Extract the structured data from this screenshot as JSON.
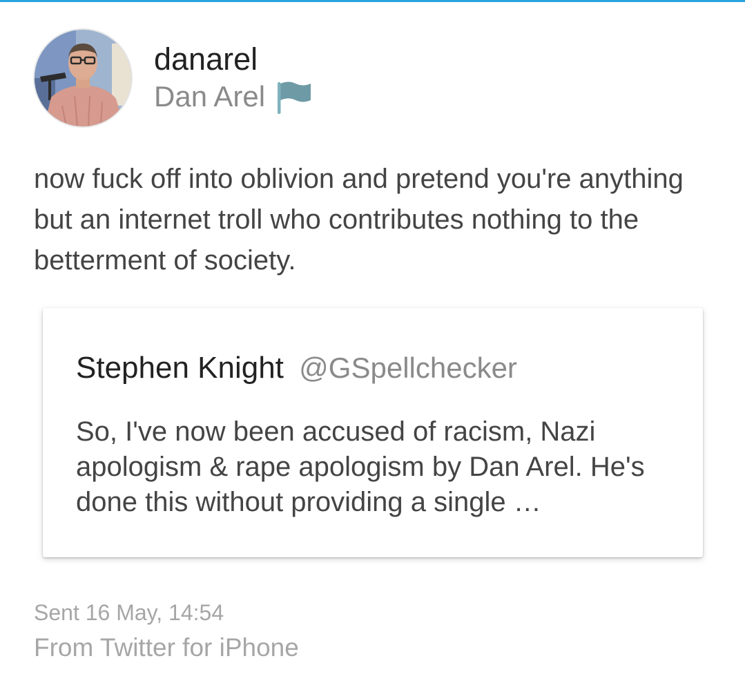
{
  "colors": {
    "accent_bar": "#29a3e0",
    "text_primary": "#222222",
    "text_body": "#444444",
    "text_secondary": "#8a8a8a",
    "text_meta": "#a6a6a6",
    "flag_icon": "#6e9aa5"
  },
  "user": {
    "username": "danarel",
    "display_name": "Dan Arel",
    "badge_icon": "flag-icon"
  },
  "tweet": {
    "text": "now fuck off into oblivion and pretend you're anything but an internet troll who contributes nothing to the betterment of society."
  },
  "quote": {
    "name": "Stephen Knight",
    "handle": "@GSpellchecker",
    "text": "So, I've now been accused of racism, Nazi apologism & rape apologism by Dan Arel. He's done this without providing a single …"
  },
  "meta": {
    "sent": "Sent 16 May, 14:54",
    "source": "From Twitter for iPhone"
  }
}
